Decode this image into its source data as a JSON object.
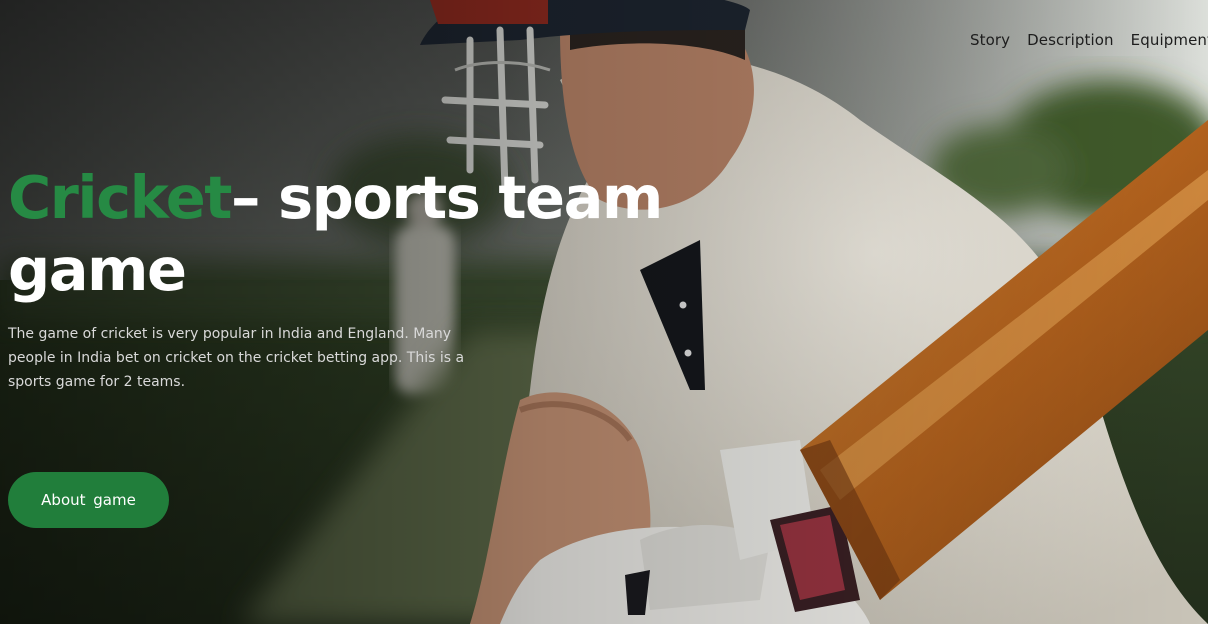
{
  "nav": {
    "items": [
      {
        "label": "Story"
      },
      {
        "label": "Description"
      },
      {
        "label": "Equipment"
      }
    ]
  },
  "hero": {
    "title_accent": "Cricket",
    "title_rest": "– sports team game",
    "description": "The game of cricket is very popular in India and England. Many people in India bet on cricket on the cricket betting app. This is a sports game for 2 teams.",
    "cta_label": "About  game",
    "image": "cricket-batsman-photo"
  },
  "colors": {
    "accent": "#268a44",
    "button": "#217e3b",
    "headline": "#ffffff",
    "nav_text": "#1d1d1d"
  }
}
